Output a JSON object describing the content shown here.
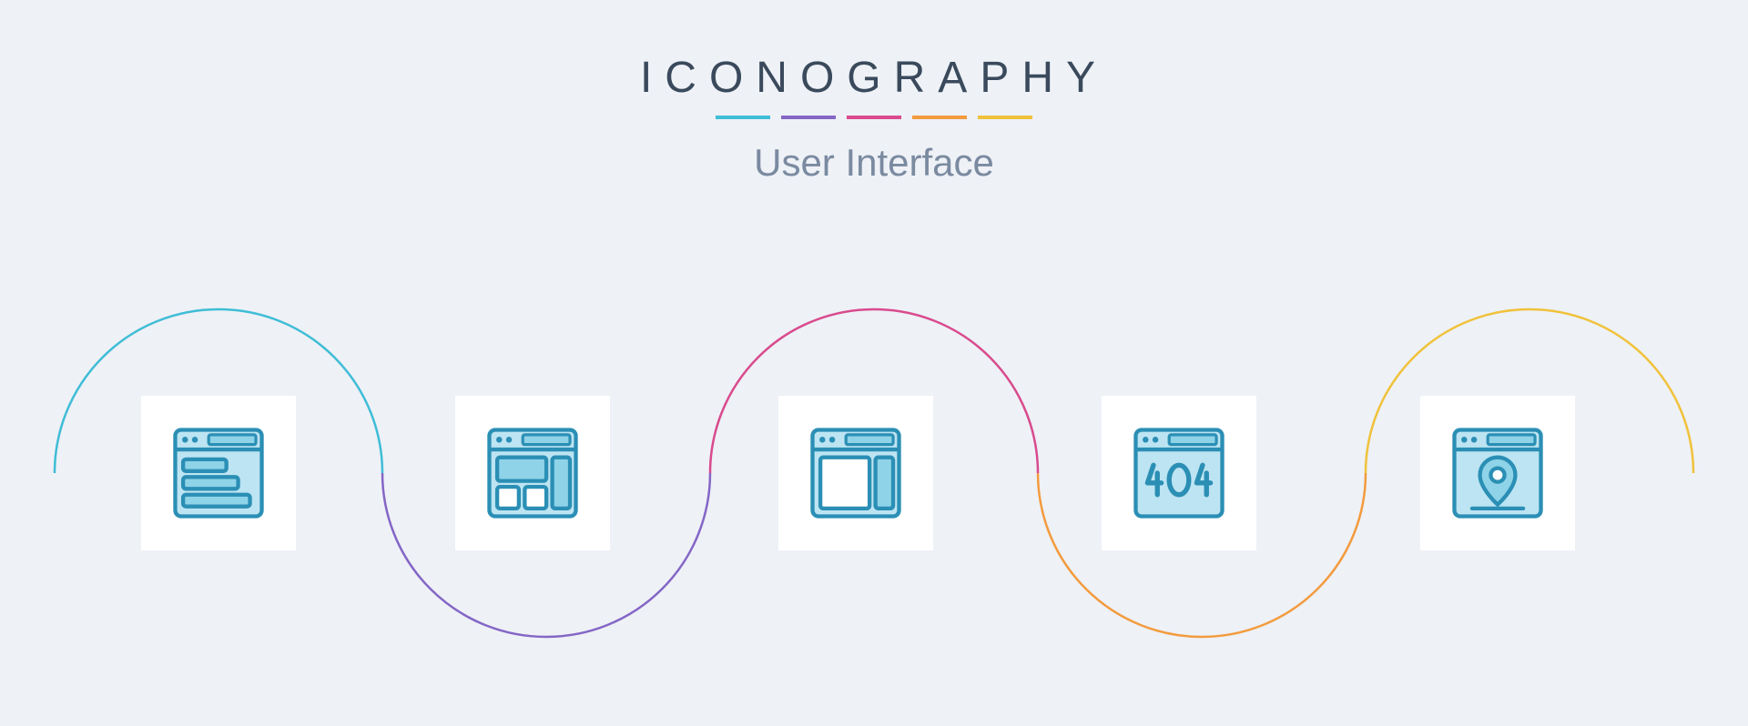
{
  "header": {
    "title": "ICONOGRAPHY",
    "subtitle": "User Interface",
    "underline_colors": [
      "#3fbdd6",
      "#8466c6",
      "#d94b8e",
      "#f39b3e",
      "#f0c23b"
    ]
  },
  "wave": {
    "segments": [
      {
        "color": "#3fbdd6"
      },
      {
        "color": "#8466c6"
      },
      {
        "color": "#d94b8e"
      },
      {
        "color": "#f39b3e"
      },
      {
        "color": "#f0c23b"
      }
    ]
  },
  "icons": [
    {
      "name": "browser-left-align-icon",
      "desc": "browser window with three left-aligned horizontal bars"
    },
    {
      "name": "browser-sidebar-layout-icon",
      "desc": "browser window with hero block and right sidebar column"
    },
    {
      "name": "browser-right-panel-icon",
      "desc": "browser window with main area and narrow right panel"
    },
    {
      "name": "browser-404-icon",
      "desc": "browser window showing 404 text",
      "text": "404"
    },
    {
      "name": "browser-location-icon",
      "desc": "browser window with map location pin"
    }
  ],
  "palette": {
    "icon_stroke": "#2b8fb5",
    "icon_fill_light": "#bde4f2",
    "icon_fill_mid": "#8fd3e8",
    "card_bg": "#ffffff",
    "page_bg": "#eef1f6"
  }
}
